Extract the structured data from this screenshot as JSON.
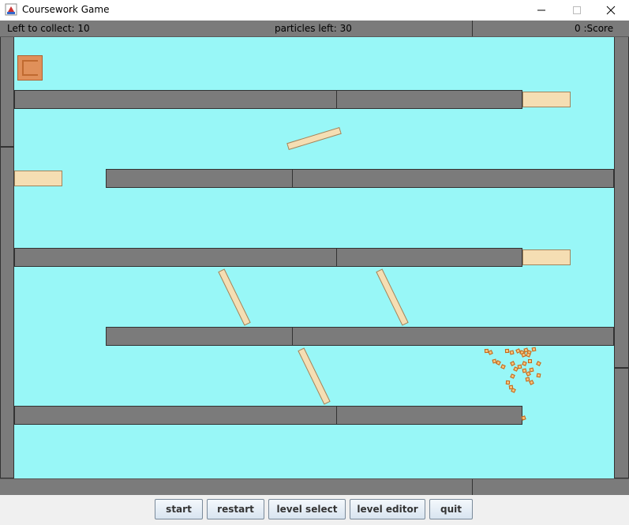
{
  "window": {
    "title": "Coursework Game"
  },
  "hud": {
    "left_to_collect": "Left to collect: 10",
    "particles_left": "particles left: 30",
    "score": "0 :Score"
  },
  "controls": {
    "start": "start",
    "restart": "restart",
    "level_select": "level select",
    "level_editor": "level editor",
    "quit": "quit"
  },
  "colors": {
    "background": "#98f7f7",
    "wall": "#7b7b7b",
    "ledge": "#f5deb3",
    "particle": "#f5c37a",
    "bucket": "#e0905a"
  }
}
